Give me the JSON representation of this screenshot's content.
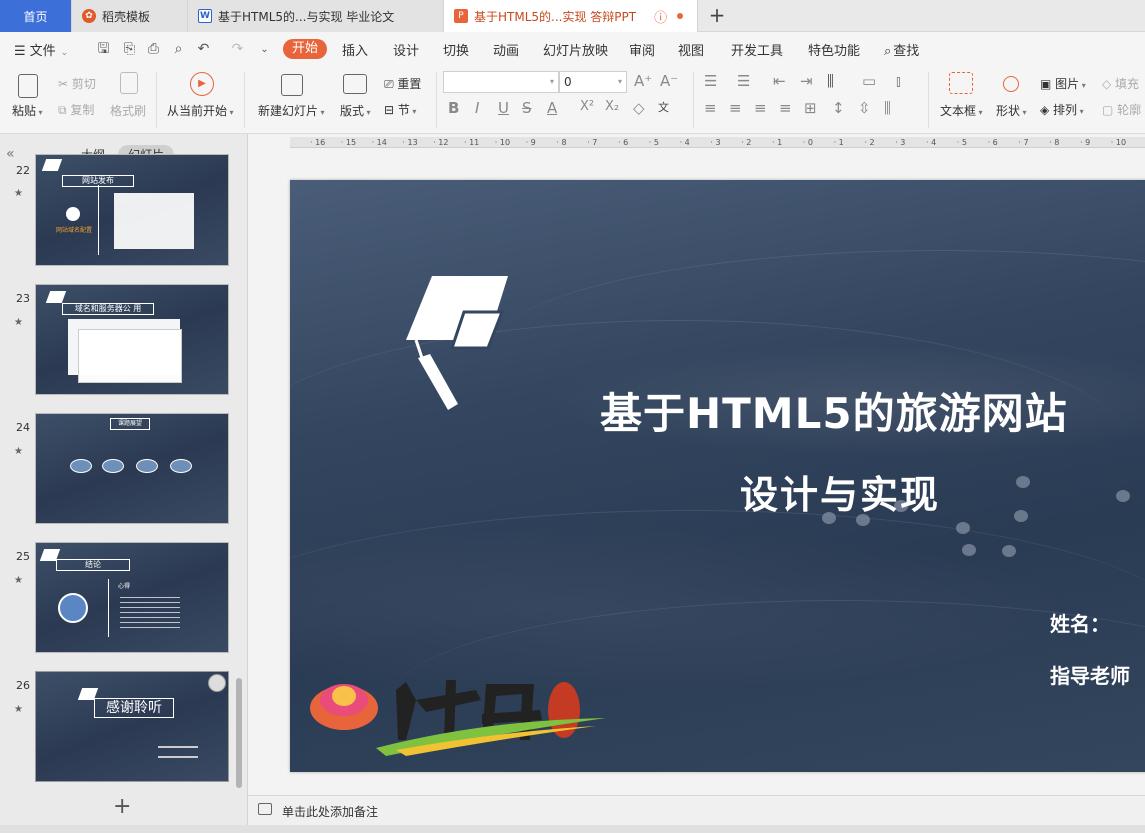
{
  "tabs": {
    "home": "首页",
    "daoke": "稻壳模板",
    "doc": "基于HTML5的...与实现 毕业论文",
    "ppt": "基于HTML5的...实现 答辩PPT"
  },
  "menu": {
    "file": "文件",
    "start": "开始",
    "insert": "插入",
    "design": "设计",
    "transition": "切换",
    "animation": "动画",
    "slideshow": "幻灯片放映",
    "review": "审阅",
    "view": "视图",
    "devtools": "开发工具",
    "special": "特色功能",
    "search": "查找"
  },
  "ribbon": {
    "paste": "粘贴",
    "cut": "剪切",
    "copy": "复制",
    "format_brush": "格式刷",
    "play_from_current": "从当前开始",
    "new_slide": "新建幻灯片",
    "layout": "版式",
    "reset": "重置",
    "section": "节",
    "font_size": "0",
    "textbox": "文本框",
    "shape": "形状",
    "picture": "图片",
    "arrange": "排列",
    "fill": "填充",
    "outline": "轮廓"
  },
  "left_panel": {
    "tab_outline": "大纲",
    "tab_slides": "幻灯片",
    "slides": [
      {
        "num": "22",
        "title": "网站发布",
        "caption": "网站域名配置"
      },
      {
        "num": "23",
        "title": "域名和服务器公 用",
        "caption": ""
      },
      {
        "num": "24",
        "title": "课题展望",
        "caption": ""
      },
      {
        "num": "25",
        "title": "结论",
        "caption": "心得"
      },
      {
        "num": "26",
        "title": "感谢聆听",
        "caption": ""
      }
    ]
  },
  "ruler_ticks": [
    "16",
    "15",
    "14",
    "13",
    "12",
    "11",
    "10",
    "9",
    "8",
    "7",
    "6",
    "5",
    "4",
    "3",
    "2",
    "1",
    "0",
    "1",
    "2",
    "3",
    "4",
    "5",
    "6",
    "7",
    "8",
    "9",
    "10"
  ],
  "slide": {
    "title_line1": "基于HTML5的旅游网站",
    "title_line2": "设计与实现",
    "name_label": "姓名：",
    "advisor_label": "指导老师"
  },
  "notes_placeholder": "单击此处添加备注"
}
